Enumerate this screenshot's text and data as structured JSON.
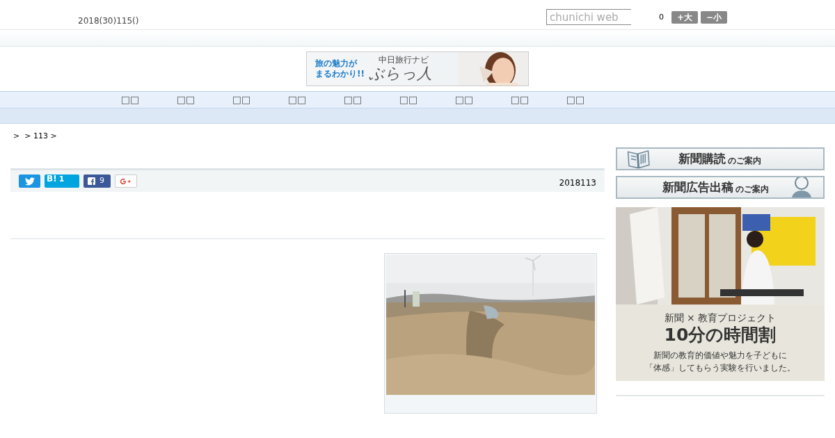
{
  "header": {
    "date": "2018(30)115()",
    "search": {
      "placeholder": "chunichi web"
    },
    "counter": "0",
    "font_buttons": [
      "+大",
      "−小"
    ]
  },
  "banner": {
    "headline": [
      "旅の魅力が",
      "まるわかり!!"
    ],
    "brand_small": "中日旅行ナビ",
    "brand": "ぶらっ人"
  },
  "nav": {
    "items": [
      "□□",
      "□□",
      "□□",
      "□□",
      "□□",
      "□□",
      "□□",
      "□□",
      "□□"
    ]
  },
  "breadcrumb": ">  > 113 >",
  "share": {
    "hatena_label": "B!",
    "hatena_count": "1",
    "facebook_count": "9",
    "date": "2018113"
  },
  "sidebar": {
    "subscribe": {
      "main": "新聞購読",
      "suffix": "のご案内"
    },
    "advertise": {
      "main": "新聞広告出稿",
      "suffix": "のご案内"
    },
    "promo": {
      "line1": "新聞 × 教育プロジェクト",
      "line2": "10分の時間割",
      "line3": [
        "新聞の教育的価値や魅力を子どもに",
        "「体感」してもらう実験を行いました。"
      ]
    }
  }
}
